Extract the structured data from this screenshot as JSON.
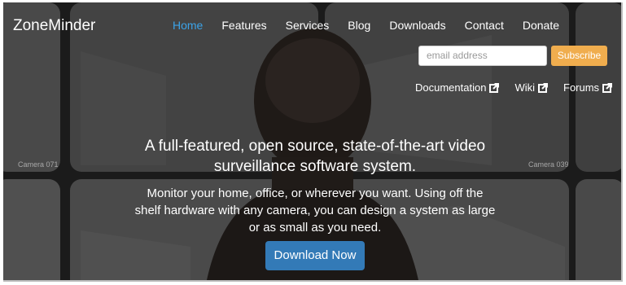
{
  "brand": "ZoneMinder",
  "nav": {
    "items": [
      "Home",
      "Features",
      "Services",
      "Blog",
      "Downloads",
      "Contact",
      "Donate"
    ],
    "active": "Home"
  },
  "subscribe": {
    "placeholder": "email address",
    "button": "Subscribe"
  },
  "links": {
    "documentation": "Documentation",
    "wiki": "Wiki",
    "forums": "Forums",
    "icon": "external-link-icon"
  },
  "hero": {
    "headline": "A full-featured, open source, state-of-the-art video surveillance software system.",
    "paragraph": "Monitor your home, office, or wherever you want. Using off the shelf hardware with any camera, you can design a system as large or as small as you need.",
    "button": "Download Now"
  },
  "camera_labels": {
    "left": "Camera 071",
    "right": "Camera 039"
  },
  "colors": {
    "accent": "#3ba3e8",
    "subscribe": "#f0ad4e",
    "download": "#337ab7"
  }
}
